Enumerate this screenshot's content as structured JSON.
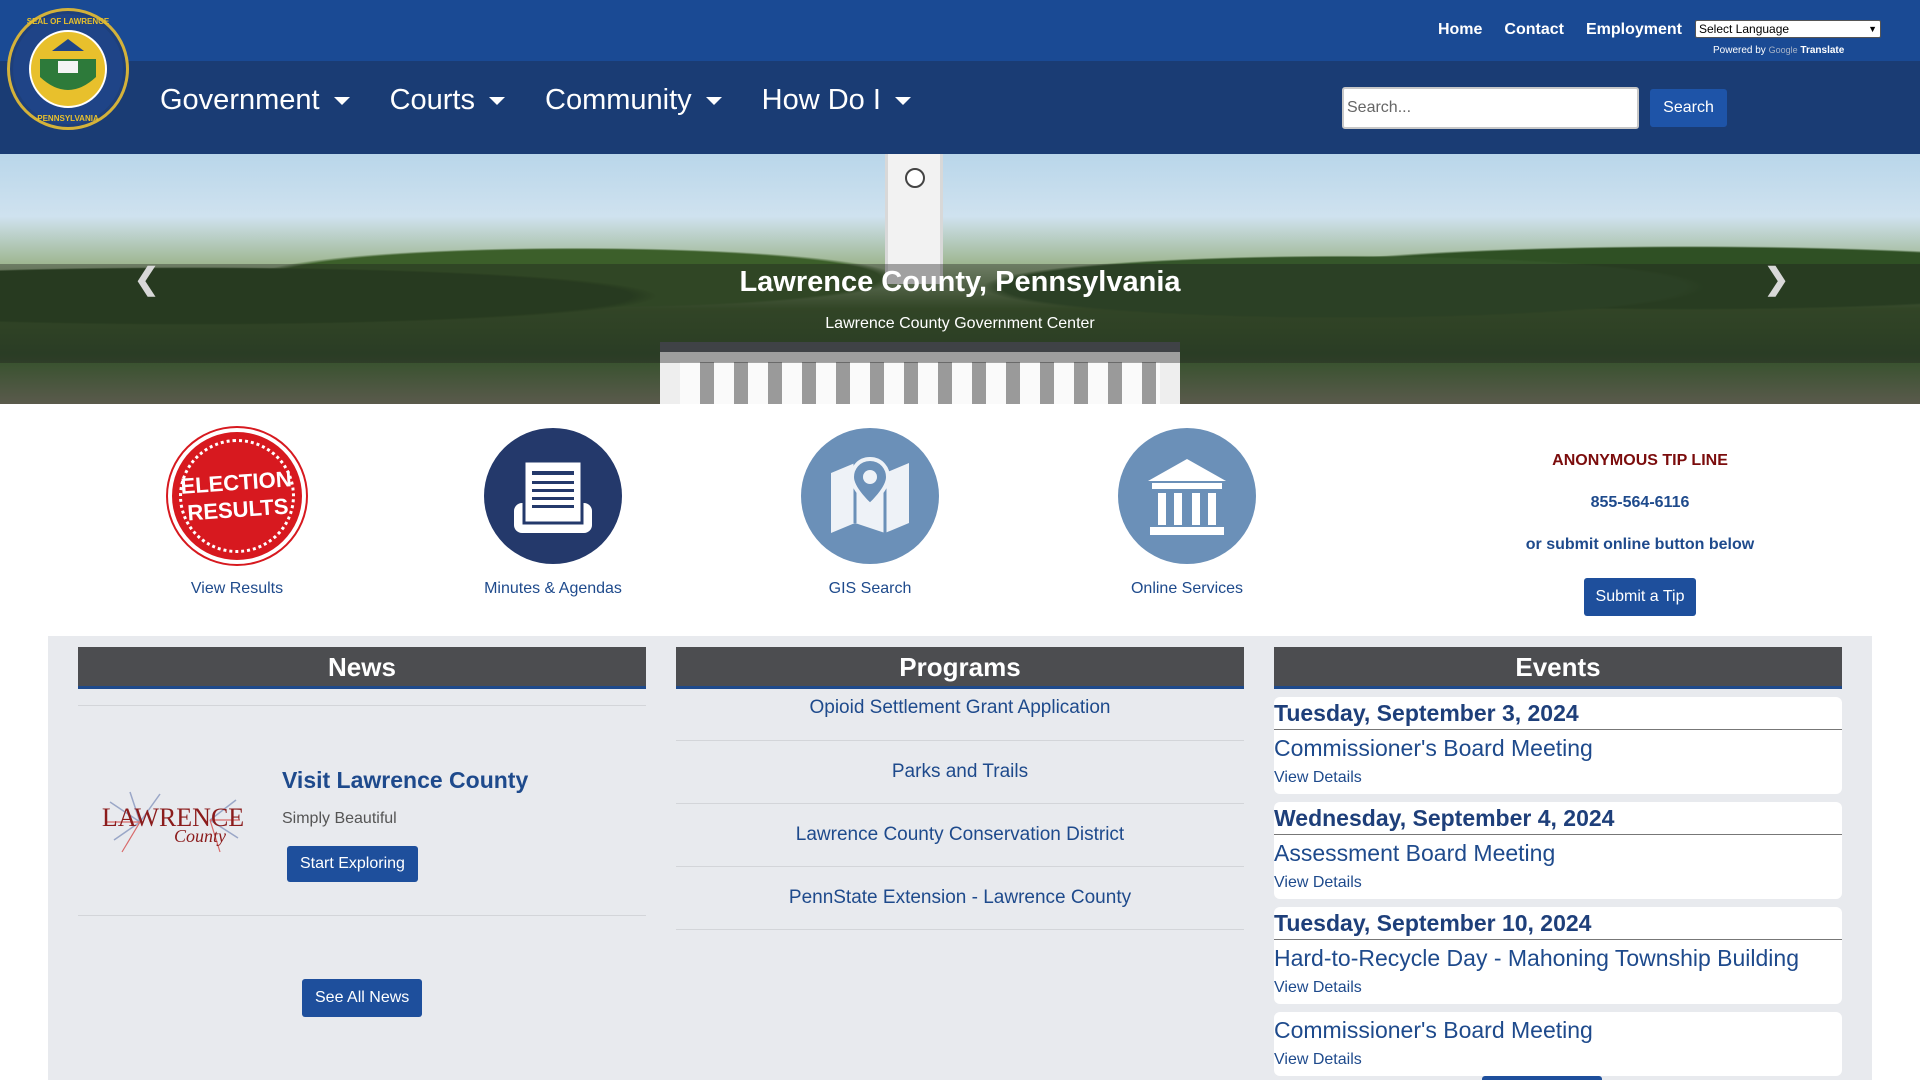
{
  "header": {
    "seal_alt": "SEAL OF LAWRENCE COUNTY, PENNSYLVANIA",
    "top_links": [
      "Home",
      "Contact",
      "Employment"
    ],
    "language_select": "Select Language",
    "powered_by": "Powered by",
    "google": "Google",
    "translate": "Translate",
    "nav": [
      "Government",
      "Courts",
      "Community",
      "How Do I"
    ],
    "search_placeholder": "Search...",
    "search_button": "Search"
  },
  "hero": {
    "title": "Lawrence County, Pennsylvania",
    "subtitle": "Lawrence County Government Center",
    "prev_icon": "chevron-left-icon",
    "next_icon": "chevron-right-icon"
  },
  "quick_links": [
    {
      "label": "View Results",
      "icon": "election-results-icon",
      "badge_line1": "ELECTION",
      "badge_line2": "RESULTS"
    },
    {
      "label": "Minutes & Agendas",
      "icon": "document-icon"
    },
    {
      "label": "GIS Search",
      "icon": "map-pin-icon"
    },
    {
      "label": "Online Services",
      "icon": "courthouse-icon"
    }
  ],
  "tip_line": {
    "title": "ANONYMOUS TIP LINE",
    "phone": "855-564-6116",
    "note": "or submit online button below",
    "button": "Submit a Tip"
  },
  "news": {
    "heading": "News",
    "item": {
      "title": "Visit Lawrence County",
      "subtitle": "Simply Beautiful",
      "button": "Start Exploring",
      "logo_text1": "LAWRENCE",
      "logo_text2": "County"
    },
    "all_button": "See All News"
  },
  "programs": {
    "heading": "Programs",
    "items": [
      "Opioid Settlement Grant Application",
      "Parks and Trails",
      "Lawrence County Conservation District",
      "PennState Extension - Lawrence County"
    ]
  },
  "events": {
    "heading": "Events",
    "items": [
      {
        "date": "Tuesday, September 3, 2024",
        "title": "Commissioner's Board Meeting",
        "link": "View Details"
      },
      {
        "date": "Wednesday, September 4, 2024",
        "title": "Assessment Board Meeting",
        "link": "View Details"
      },
      {
        "date": "Tuesday, September 10, 2024",
        "title": "Hard-to-Recycle Day - Mahoning Township Building",
        "link": "View Details"
      },
      {
        "date": "",
        "title": "Commissioner's Board Meeting",
        "link": "View Details"
      }
    ]
  },
  "colors": {
    "header_top": "#1a4a94",
    "header_main": "#1a3c74",
    "accent": "#1e4f9c",
    "link": "#1e4a8c",
    "tip_title": "#7b0c0c",
    "section_head": "#4c4d50",
    "election_red": "#d7191f"
  }
}
